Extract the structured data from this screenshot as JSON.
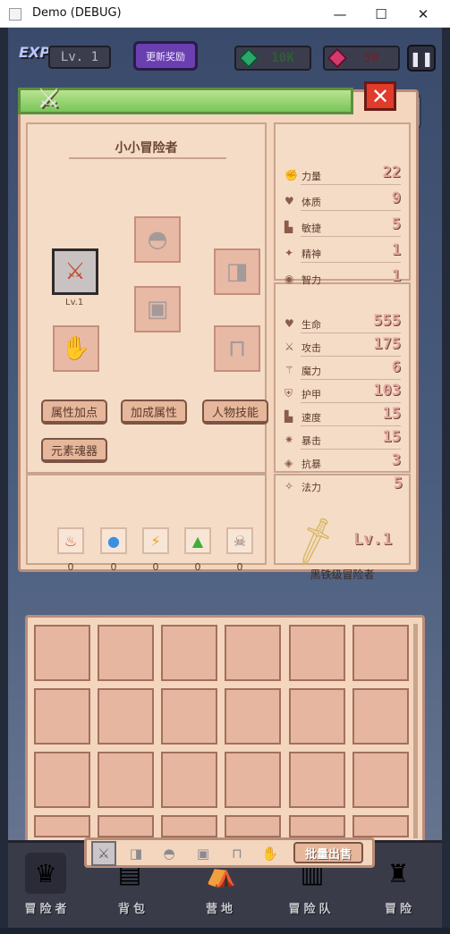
{
  "window": {
    "title": "Demo (DEBUG)",
    "min": "—",
    "max": "☐",
    "close": "✕"
  },
  "hud": {
    "exp_label": "EXP",
    "level": "Lv. 1",
    "update_reward": "更新奖励",
    "green_gems": "10K",
    "red_gems": "50",
    "pause_icon": "pause-icon"
  },
  "panel": {
    "character_name": "小小冒险者",
    "weapon_level": "Lv.1",
    "buttons": [
      "属性加点",
      "加成属性",
      "人物技能",
      "元素魂器"
    ],
    "base_stats": [
      {
        "label": "力量",
        "value": "22",
        "icon": "fist-icon"
      },
      {
        "label": "体质",
        "value": "9",
        "icon": "heart-icon"
      },
      {
        "label": "敏捷",
        "value": "5",
        "icon": "boot-icon"
      },
      {
        "label": "精神",
        "value": "1",
        "icon": "star-icon"
      },
      {
        "label": "智力",
        "value": "1",
        "icon": "brain-icon"
      }
    ],
    "combat_stats": [
      {
        "label": "生命",
        "value": "555",
        "icon": "heart-icon"
      },
      {
        "label": "攻击",
        "value": "175",
        "icon": "sword-icon"
      },
      {
        "label": "魔力",
        "value": "6",
        "icon": "wand-icon"
      },
      {
        "label": "护甲",
        "value": "103",
        "icon": "shield-icon"
      },
      {
        "label": "速度",
        "value": "15",
        "icon": "boot-icon"
      },
      {
        "label": "暴击",
        "value": "15",
        "icon": "crit-icon"
      },
      {
        "label": "抗暴",
        "value": "3",
        "icon": "resist-icon"
      },
      {
        "label": "法力",
        "value": "5",
        "icon": "mana-icon"
      }
    ],
    "elements": [
      {
        "icon": "fire-icon",
        "value": "0",
        "color": "#e2492a"
      },
      {
        "icon": "water-icon",
        "value": "0",
        "color": "#3b8fe0"
      },
      {
        "icon": "lightning-icon",
        "value": "0",
        "color": "#f0a020"
      },
      {
        "icon": "earth-icon",
        "value": "0",
        "color": "#3fae3a"
      },
      {
        "icon": "skull-icon",
        "value": "0",
        "color": "#8e6c6c"
      }
    ],
    "rank": {
      "level": "Lv.1",
      "title": "黑铁级冒险者"
    }
  },
  "inventory": {
    "bulk_sell": "批量出售",
    "tabs": [
      "sword-icon",
      "armor-icon",
      "helmet-icon",
      "chest-icon",
      "pants-icon",
      "glove-icon"
    ]
  },
  "nav": [
    "冒险者",
    "背包",
    "营地",
    "冒险队",
    "冒险"
  ]
}
